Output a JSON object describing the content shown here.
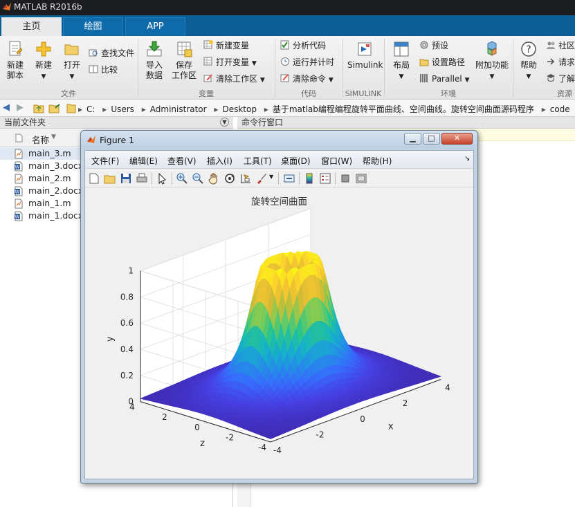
{
  "app": {
    "title": "MATLAB R2016b"
  },
  "tabs": [
    {
      "label": "主页"
    },
    {
      "label": "绘图"
    },
    {
      "label": "APP"
    }
  ],
  "ribbon": {
    "new_script": "新建\n脚本",
    "new_script_l1": "新建",
    "new_script_l2": "脚本",
    "new": "新建",
    "open": "打开",
    "find_files": "查找文件",
    "compare": "比较",
    "import_l1": "导入",
    "import_l2": "数据",
    "save_l1": "保存",
    "save_l2": "工作区",
    "new_var": "新建变量",
    "open_var": "打开变量",
    "clear_ws": "清除工作区",
    "analyze": "分析代码",
    "run_time": "运行并计时",
    "clear_cmd": "清除命令",
    "simulink": "Simulink",
    "layout": "布局",
    "preferences": "预设",
    "set_path": "设置路径",
    "parallel": "Parallel",
    "addons": "附加功能",
    "help": "帮助",
    "community": "社区",
    "request": "请求",
    "learn": "了解",
    "groups": {
      "file": "文件",
      "variable": "变量",
      "code": "代码",
      "simulink": "SIMULINK",
      "env": "环境",
      "resources": "资源"
    }
  },
  "address": {
    "crumbs": [
      "C:",
      "Users",
      "Administrator",
      "Desktop",
      "基于matlab编程编程旋转平面曲线、空间曲线。旋转空间曲面源码程序",
      "code"
    ]
  },
  "panels": {
    "current_folder": "当前文件夹",
    "command_window": "命令行窗口",
    "name_col": "名称"
  },
  "files": [
    {
      "name": "main_3.m",
      "type": "m"
    },
    {
      "name": "main_3.docx",
      "type": "docx"
    },
    {
      "name": "main_2.m",
      "type": "m"
    },
    {
      "name": "main_2.docx",
      "type": "docx"
    },
    {
      "name": "main_1.m",
      "type": "m"
    },
    {
      "name": "main_1.docx",
      "type": "docx"
    }
  ],
  "figure": {
    "title": "Figure 1",
    "menu": [
      "文件(F)",
      "编辑(E)",
      "查看(V)",
      "插入(I)",
      "工具(T)",
      "桌面(D)",
      "窗口(W)",
      "帮助(H)"
    ],
    "plot_title": "旋转空间曲面",
    "xlabel": "x",
    "ylabel": "y",
    "zlabel": "z"
  },
  "chart_data": {
    "type": "surface",
    "title": "旋转空间曲面",
    "xlabel": "x",
    "ylabel": "y",
    "zlabel": "z",
    "x_ticks": [
      "-4",
      "-2",
      "0",
      "2",
      "4"
    ],
    "z_ticks": [
      "-4",
      "-2",
      "0",
      "2",
      "4"
    ],
    "y_ticks": [
      "0",
      "0.2",
      "0.4",
      "0.6",
      "0.8",
      "1"
    ],
    "xlim": [
      -4,
      4
    ],
    "zlim": [
      -4,
      4
    ],
    "ylim": [
      0,
      1
    ],
    "colormap": "parula",
    "grid": true
  }
}
